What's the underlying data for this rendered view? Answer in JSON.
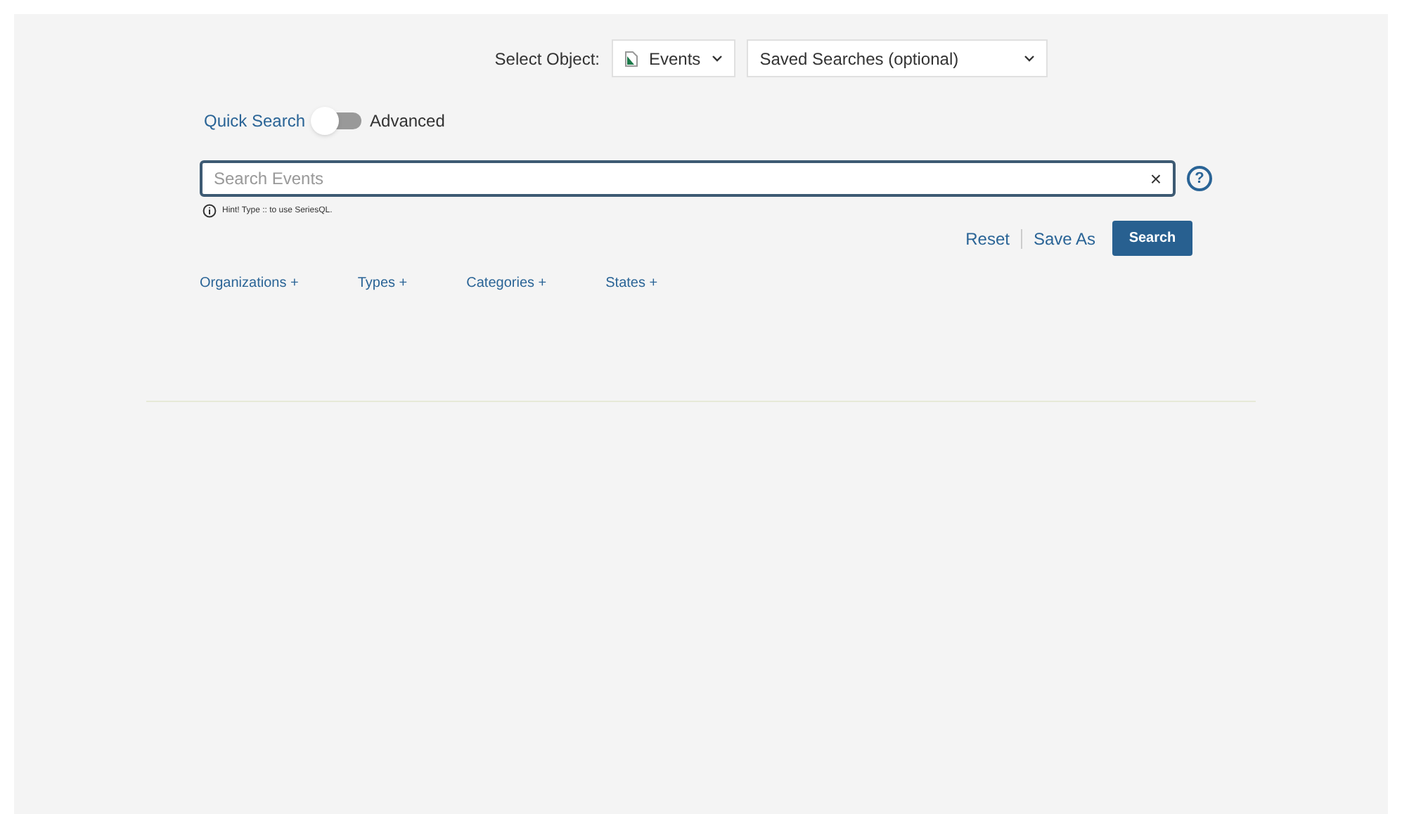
{
  "select_object": {
    "label": "Select Object:",
    "value": "Events"
  },
  "saved_searches": {
    "value": "Saved Searches (optional)"
  },
  "mode_toggle": {
    "left_label": "Quick Search",
    "right_label": "Advanced",
    "on": false
  },
  "search": {
    "placeholder": "Search Events",
    "clear": "×",
    "help": "?"
  },
  "hint": "Hint! Type :: to use SeriesQL.",
  "actions": {
    "reset": "Reset",
    "save_as": "Save As",
    "search": "Search"
  },
  "filters": [
    "Organizations +",
    "Types +",
    "Categories +",
    "States +"
  ]
}
